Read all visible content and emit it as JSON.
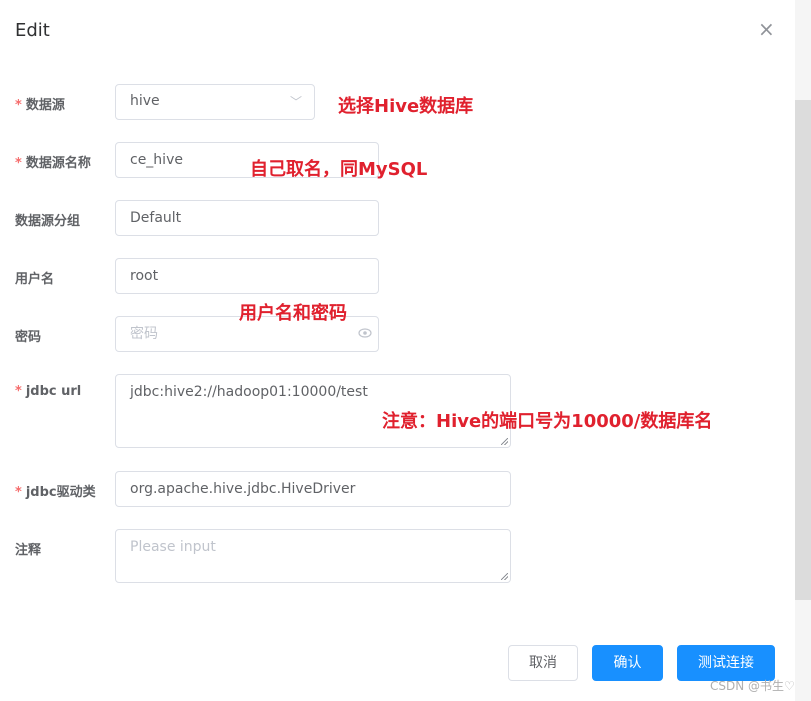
{
  "dialog": {
    "title": "Edit",
    "close_glyph": "×"
  },
  "form": {
    "datasource": {
      "label": "数据源",
      "value": "hive",
      "icon": "chevron-down-icon"
    },
    "datasource_name": {
      "label": "数据源名称",
      "value": "ce_hive"
    },
    "datasource_group": {
      "label": "数据源分组",
      "value": "Default"
    },
    "username": {
      "label": "用户名",
      "value": "root"
    },
    "password": {
      "label": "密码",
      "placeholder": "密码",
      "icon": "eye-icon"
    },
    "jdbc_url": {
      "label": "jdbc url",
      "value": "jdbc:hive2://hadoop01:10000/test"
    },
    "jdbc_driver": {
      "label": "jdbc驱动类",
      "value": "org.apache.hive.jdbc.HiveDriver"
    },
    "comment": {
      "label": "注释",
      "placeholder": "Please input"
    }
  },
  "annotations": {
    "datasource_note": "选择Hive数据库",
    "name_note": "自己取名，同MySQL",
    "credentials_note": "用户名和密码",
    "url_note": "注意：Hive的端口号为10000/数据库名"
  },
  "buttons": {
    "cancel": "取消",
    "confirm": "确认",
    "test_connection": "测试连接"
  },
  "watermark": "CSDN @书生♡",
  "colors": {
    "primary": "#1890ff",
    "required": "#f56c6c",
    "annotation": "#e0212e"
  }
}
